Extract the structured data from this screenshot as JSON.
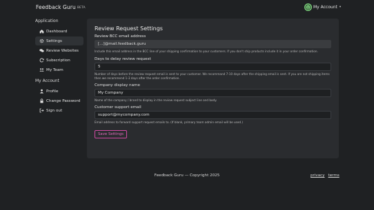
{
  "header": {
    "brand": "Feedback Guru",
    "beta": "BETA",
    "account_label": "My Account",
    "caret": "▾"
  },
  "sidebar": {
    "application_heading": "Application",
    "application_items": [
      {
        "label": "Dashboard",
        "icon": "home-icon"
      },
      {
        "label": "Settings",
        "icon": "gear-icon",
        "active": true
      },
      {
        "label": "Review Websites",
        "icon": "chat-icon"
      },
      {
        "label": "Subscription",
        "icon": "refresh-icon"
      },
      {
        "label": "My Team",
        "icon": "team-icon"
      }
    ],
    "account_heading": "My Account",
    "account_items": [
      {
        "label": "Profile",
        "icon": "user-icon"
      },
      {
        "label": "Change Password",
        "icon": "lock-icon"
      },
      {
        "label": "Sign out",
        "icon": "sign-out-icon"
      }
    ]
  },
  "form": {
    "title": "Review Request Settings",
    "bcc": {
      "label": "Review BCC email address",
      "value": "[...]@mail.feedback.guru",
      "help": "Include this email address in the BCC line of your shipping confirmation to your customers. If you don't ship products include it in your order confirmation."
    },
    "days": {
      "label": "Days to delay review request",
      "value": "5",
      "help": "Number of days before the review request email is sent to your customer. We recommand 7-10 days after the shipping email is sent. If you are not shipping items then we recommend 1-3 days after the order confirmation."
    },
    "company": {
      "label": "Company display name",
      "value": "My Company",
      "help": "Name of the company / brand to display in the review request subject line and body."
    },
    "support": {
      "label": "Customer support email",
      "value": "support@mycompany.com",
      "help": "Email address to forward support request emails to.  (If blank, primary team admin email will be used.)"
    },
    "save_label": "Save Settings"
  },
  "footer": {
    "copyright": "Feedback Guru — Copyright 2025",
    "privacy": "privacy",
    "terms": "terms"
  },
  "colors": {
    "background": "#1f2123",
    "panel": "#2a2c2f",
    "accent": "#d24aa5",
    "avatar": "#7bd47b"
  }
}
